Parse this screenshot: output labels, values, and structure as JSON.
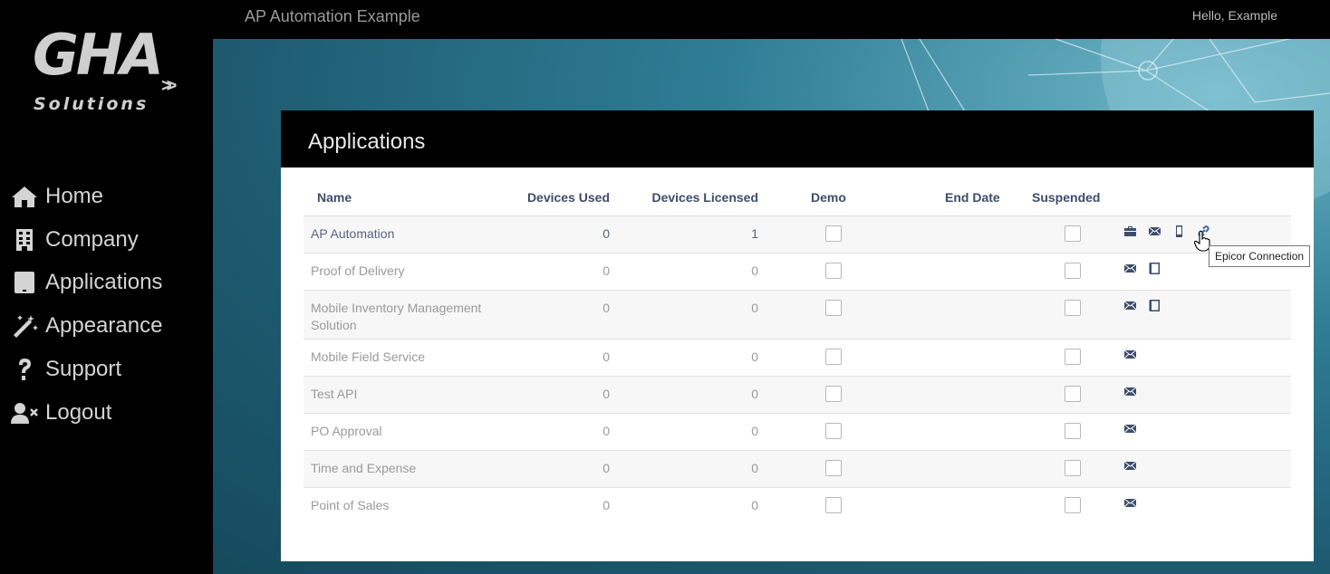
{
  "app": {
    "title": "AP Automation Example",
    "greeting": "Hello, Example"
  },
  "logo": {
    "main": "GHA",
    "sub": "Solutions",
    "arrows": ">>"
  },
  "sidebar": {
    "items": [
      {
        "label": "Home",
        "icon": "home-icon"
      },
      {
        "label": "Company",
        "icon": "building-icon"
      },
      {
        "label": "Applications",
        "icon": "tablet-icon"
      },
      {
        "label": "Appearance",
        "icon": "magic-wand-icon"
      },
      {
        "label": "Support",
        "icon": "question-icon"
      },
      {
        "label": "Logout",
        "icon": "user-times-icon"
      }
    ]
  },
  "panel": {
    "title": "Applications"
  },
  "table": {
    "headers": [
      "Name",
      "Devices Used",
      "Devices Licensed",
      "Demo",
      "End Date",
      "Suspended"
    ],
    "rows": [
      {
        "name": "AP Automation",
        "used": "0",
        "licensed": "1",
        "end": ""
      },
      {
        "name": "Proof of Delivery",
        "used": "0",
        "licensed": "0",
        "end": ""
      },
      {
        "name": "Mobile Inventory Management Solution",
        "used": "0",
        "licensed": "0",
        "end": ""
      },
      {
        "name": "Mobile Field Service",
        "used": "0",
        "licensed": "0",
        "end": ""
      },
      {
        "name": "Test API",
        "used": "0",
        "licensed": "0",
        "end": ""
      },
      {
        "name": "PO Approval",
        "used": "0",
        "licensed": "0",
        "end": ""
      },
      {
        "name": "Time and Expense",
        "used": "0",
        "licensed": "0",
        "end": ""
      },
      {
        "name": "Point of Sales",
        "used": "0",
        "licensed": "0",
        "end": ""
      }
    ]
  },
  "tooltip": {
    "text": "Epicor Connection"
  },
  "colors": {
    "accent": "#3d4d6b",
    "link": "#3d6ab0",
    "sidebar_bg": "#000000"
  }
}
